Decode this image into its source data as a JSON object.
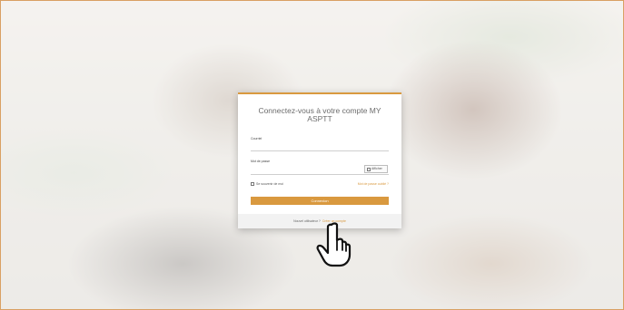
{
  "login": {
    "title": "Connectez-vous à votre compte MY ASPTT",
    "username_label": "Courriel",
    "password_label": "Mot de passe",
    "show_label": "Afficher",
    "remember_label": "Se souvenir de moi",
    "forgot_label": "Mot de passe oublié ?",
    "submit_label": "Connexion",
    "footer_text": "Nouvel utilisateur ?",
    "footer_link": "Créer un compte"
  },
  "colors": {
    "accent": "#d9993f",
    "frame_border": "#d9a063"
  },
  "icons": {
    "cursor": "hand-pointer-icon"
  }
}
